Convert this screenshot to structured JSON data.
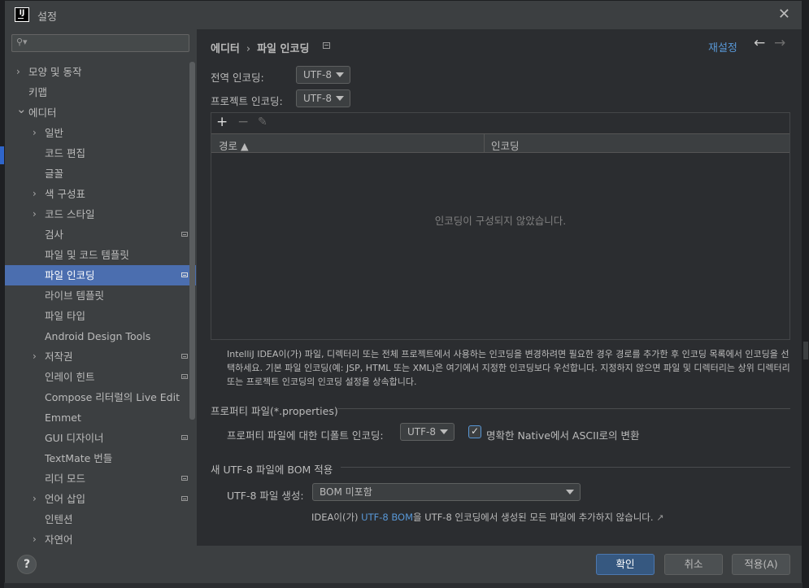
{
  "window": {
    "title": "설정",
    "app_icon_text": "IJ"
  },
  "search": {
    "placeholder": ""
  },
  "sidebar": {
    "items": [
      {
        "label": "모양 및 동작",
        "arrow": true,
        "indent": 0,
        "pg": false,
        "selected": false
      },
      {
        "label": "키맵",
        "arrow": false,
        "indent": 0,
        "pg": false,
        "selected": false
      },
      {
        "label": "에디터",
        "arrow": "down",
        "indent": 0,
        "pg": false,
        "selected": false
      },
      {
        "label": "일반",
        "arrow": true,
        "indent": 1,
        "pg": false,
        "selected": false
      },
      {
        "label": "코드 편집",
        "arrow": false,
        "indent": 1,
        "pg": false,
        "selected": false
      },
      {
        "label": "글꼴",
        "arrow": false,
        "indent": 1,
        "pg": false,
        "selected": false
      },
      {
        "label": "색 구성표",
        "arrow": true,
        "indent": 1,
        "pg": false,
        "selected": false
      },
      {
        "label": "코드 스타일",
        "arrow": true,
        "indent": 1,
        "pg": false,
        "selected": false
      },
      {
        "label": "검사",
        "arrow": false,
        "indent": 1,
        "pg": true,
        "selected": false
      },
      {
        "label": "파일 및 코드 템플릿",
        "arrow": false,
        "indent": 1,
        "pg": false,
        "selected": false
      },
      {
        "label": "파일 인코딩",
        "arrow": false,
        "indent": 1,
        "pg": true,
        "selected": true
      },
      {
        "label": "라이브 템플릿",
        "arrow": false,
        "indent": 1,
        "pg": false,
        "selected": false
      },
      {
        "label": "파일 타입",
        "arrow": false,
        "indent": 1,
        "pg": false,
        "selected": false
      },
      {
        "label": "Android Design Tools",
        "arrow": false,
        "indent": 1,
        "pg": false,
        "selected": false
      },
      {
        "label": "저작권",
        "arrow": true,
        "indent": 1,
        "pg": true,
        "selected": false
      },
      {
        "label": "인레이 힌트",
        "arrow": false,
        "indent": 1,
        "pg": true,
        "selected": false
      },
      {
        "label": "Compose 리터럴의 Live Edit",
        "arrow": false,
        "indent": 1,
        "pg": false,
        "selected": false
      },
      {
        "label": "Emmet",
        "arrow": false,
        "indent": 1,
        "pg": false,
        "selected": false
      },
      {
        "label": "GUI 디자이너",
        "arrow": false,
        "indent": 1,
        "pg": true,
        "selected": false
      },
      {
        "label": "TextMate 번들",
        "arrow": false,
        "indent": 1,
        "pg": false,
        "selected": false
      },
      {
        "label": "리더 모드",
        "arrow": false,
        "indent": 1,
        "pg": true,
        "selected": false
      },
      {
        "label": "언어 삽입",
        "arrow": true,
        "indent": 1,
        "pg": true,
        "selected": false
      },
      {
        "label": "인텐션",
        "arrow": false,
        "indent": 1,
        "pg": false,
        "selected": false
      },
      {
        "label": "자연어",
        "arrow": true,
        "indent": 1,
        "pg": false,
        "selected": false
      }
    ]
  },
  "header": {
    "breadcrumb_parent": "에디터",
    "breadcrumb_sep": "›",
    "breadcrumb_current": "파일 인코딩",
    "reset_label": "재설정",
    "back_icon": "←",
    "forward_icon": "→"
  },
  "encoding": {
    "global_label": "전역 인코딩:",
    "global_value": "UTF-8",
    "project_label": "프로젝트 인코딩:",
    "project_value": "UTF-8"
  },
  "table": {
    "toolbar": {
      "add": "+",
      "remove": "−",
      "edit": "✎"
    },
    "col_path": "경로 ▲",
    "col_encoding": "인코딩",
    "empty_text": "인코딩이 구성되지 않았습니다."
  },
  "help_text": "IntelliJ IDEA이(가) 파일, 디렉터리 또는 전체 프로젝트에서 사용하는 인코딩을 변경하려면 필요한 경우 경로를 추가한 후 인코딩 목록에서 인코딩을 선택하세요. 기본 파일 인코딩(예: JSP, HTML 또는 XML)은 여기에서 지정한 인코딩보다 우선합니다. 지정하지 않으면 파일 및 디렉터리는 상위 디렉터리 또는 프로젝트 인코딩의 인코딩 설정을 상속합니다.",
  "properties": {
    "section_title": "프로퍼티 파일(*.properties)",
    "default_label": "프로퍼티 파일에 대한 디폴트 인코딩:",
    "default_value": "UTF-8",
    "native_checkbox_label": "명확한 Native에서 ASCII로의 변환",
    "native_checked": true
  },
  "bom": {
    "section_title": "새 UTF-8 파일에 BOM 적용",
    "create_label": "UTF-8 파일 생성:",
    "create_value": "BOM 미포함",
    "info_prefix": "IDEA이(가) ",
    "info_link": "UTF-8 BOM",
    "info_suffix": "을 UTF-8 인코딩에서 생성된 모든 파일에 추가하지 않습니다.",
    "info_arrow": "↗"
  },
  "footer": {
    "help_label": "?",
    "ok_label": "확인",
    "cancel_label": "취소",
    "apply_label": "적용(A)"
  },
  "colors": {
    "accent": "#5897d6",
    "selection": "#4b6eaf",
    "primary_button": "#365880"
  }
}
